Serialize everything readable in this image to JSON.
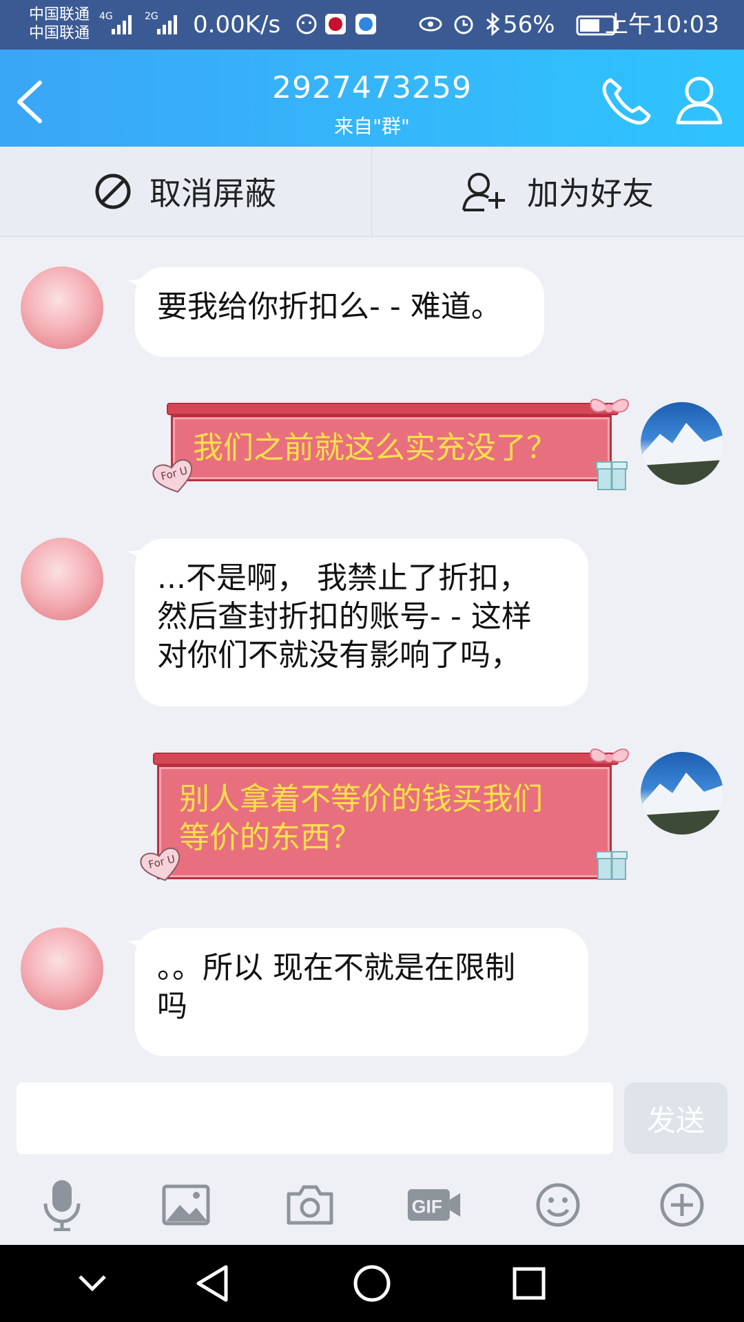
{
  "status_bar": {
    "carrier1": "中国联通",
    "carrier2": "中国联通",
    "net1": "4G",
    "net2": "2G",
    "speed": "0.00K/s",
    "battery": "56%",
    "time": "上午10:03"
  },
  "header": {
    "title": "2927473259",
    "subtitle": "来自\"群\""
  },
  "actions": {
    "unblock_label": "取消屏蔽",
    "add_friend_label": "加为好友"
  },
  "messages": [
    {
      "side": "left",
      "type": "text",
      "text": "要我给你折扣么- - 难道。"
    },
    {
      "side": "right",
      "type": "gift",
      "text": "我们之前就这么实充没了？"
    },
    {
      "side": "left",
      "type": "text",
      "lines": [
        "...不是啊， 我禁止了折扣，",
        "然后查封折扣的账号- - 这样",
        "对你们不就没有影响了吗，"
      ]
    },
    {
      "side": "right",
      "type": "gift",
      "lines": [
        "别人拿着不等价的钱买我们",
        "等价的东西？"
      ]
    },
    {
      "side": "left",
      "type": "text",
      "lines": [
        "。。所以 现在不就是在限制",
        "吗"
      ]
    }
  ],
  "gift_tag": "For U",
  "input": {
    "placeholder": "",
    "send_label": "发送"
  },
  "colors": {
    "header": "#35b4fa",
    "gift_text": "#ffe14a",
    "gift_body": "#e8707e"
  },
  "toolbar_icons": [
    "mic-icon",
    "image-icon",
    "camera-icon",
    "gif-icon",
    "emoji-icon",
    "plus-icon"
  ],
  "nav_icons": [
    "chevron-down-icon",
    "back-icon",
    "home-icon",
    "recents-icon"
  ]
}
